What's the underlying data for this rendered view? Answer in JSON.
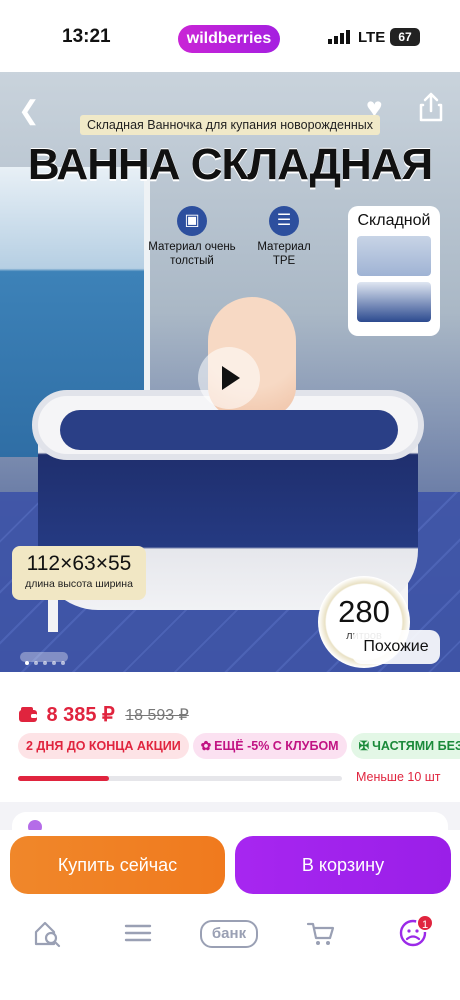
{
  "status_bar": {
    "time": "13:21",
    "brand": "wildberries",
    "network": "LTE",
    "battery": "67"
  },
  "product_media": {
    "subtitle": "Складная Ванночка для купания новорожденных",
    "headline": "ВАННА СКЛАДНАЯ",
    "features": [
      {
        "icon": "cube-icon",
        "label": "Материал очень толстый"
      },
      {
        "icon": "layers-icon",
        "label": "Материал TPE"
      }
    ],
    "fold_label": "Складной",
    "dimensions": {
      "value": "112×63×55",
      "labels": "длина  высота  ширина"
    },
    "capacity": {
      "value": "280",
      "unit": "литров"
    },
    "similar_label": "Похожие",
    "slide_index": 1,
    "slide_count": 5
  },
  "price": {
    "current": "8 385 ₽",
    "old": "18 593 ₽",
    "accent_color": "#e0243e"
  },
  "promos": [
    {
      "text": "2 ДНЯ ДО КОНЦА АКЦИИ",
      "style": "red"
    },
    {
      "text": "ЕЩЁ -5% С КЛУБОМ",
      "style": "pink",
      "icon": "club-icon"
    },
    {
      "text": "ЧАСТЯМИ БЕЗ",
      "style": "green",
      "icon": "clover-icon"
    }
  ],
  "stock": {
    "label": "Меньше 10 шт",
    "level": 0.28
  },
  "actions": {
    "buy_now": "Купить сейчас",
    "add_to_cart": "В корзину"
  },
  "tabbar": {
    "bank_label": "банк",
    "profile_badge": "1",
    "icons": [
      "home-search-icon",
      "menu-icon",
      "bank-icon",
      "cart-icon",
      "profile-icon"
    ]
  }
}
